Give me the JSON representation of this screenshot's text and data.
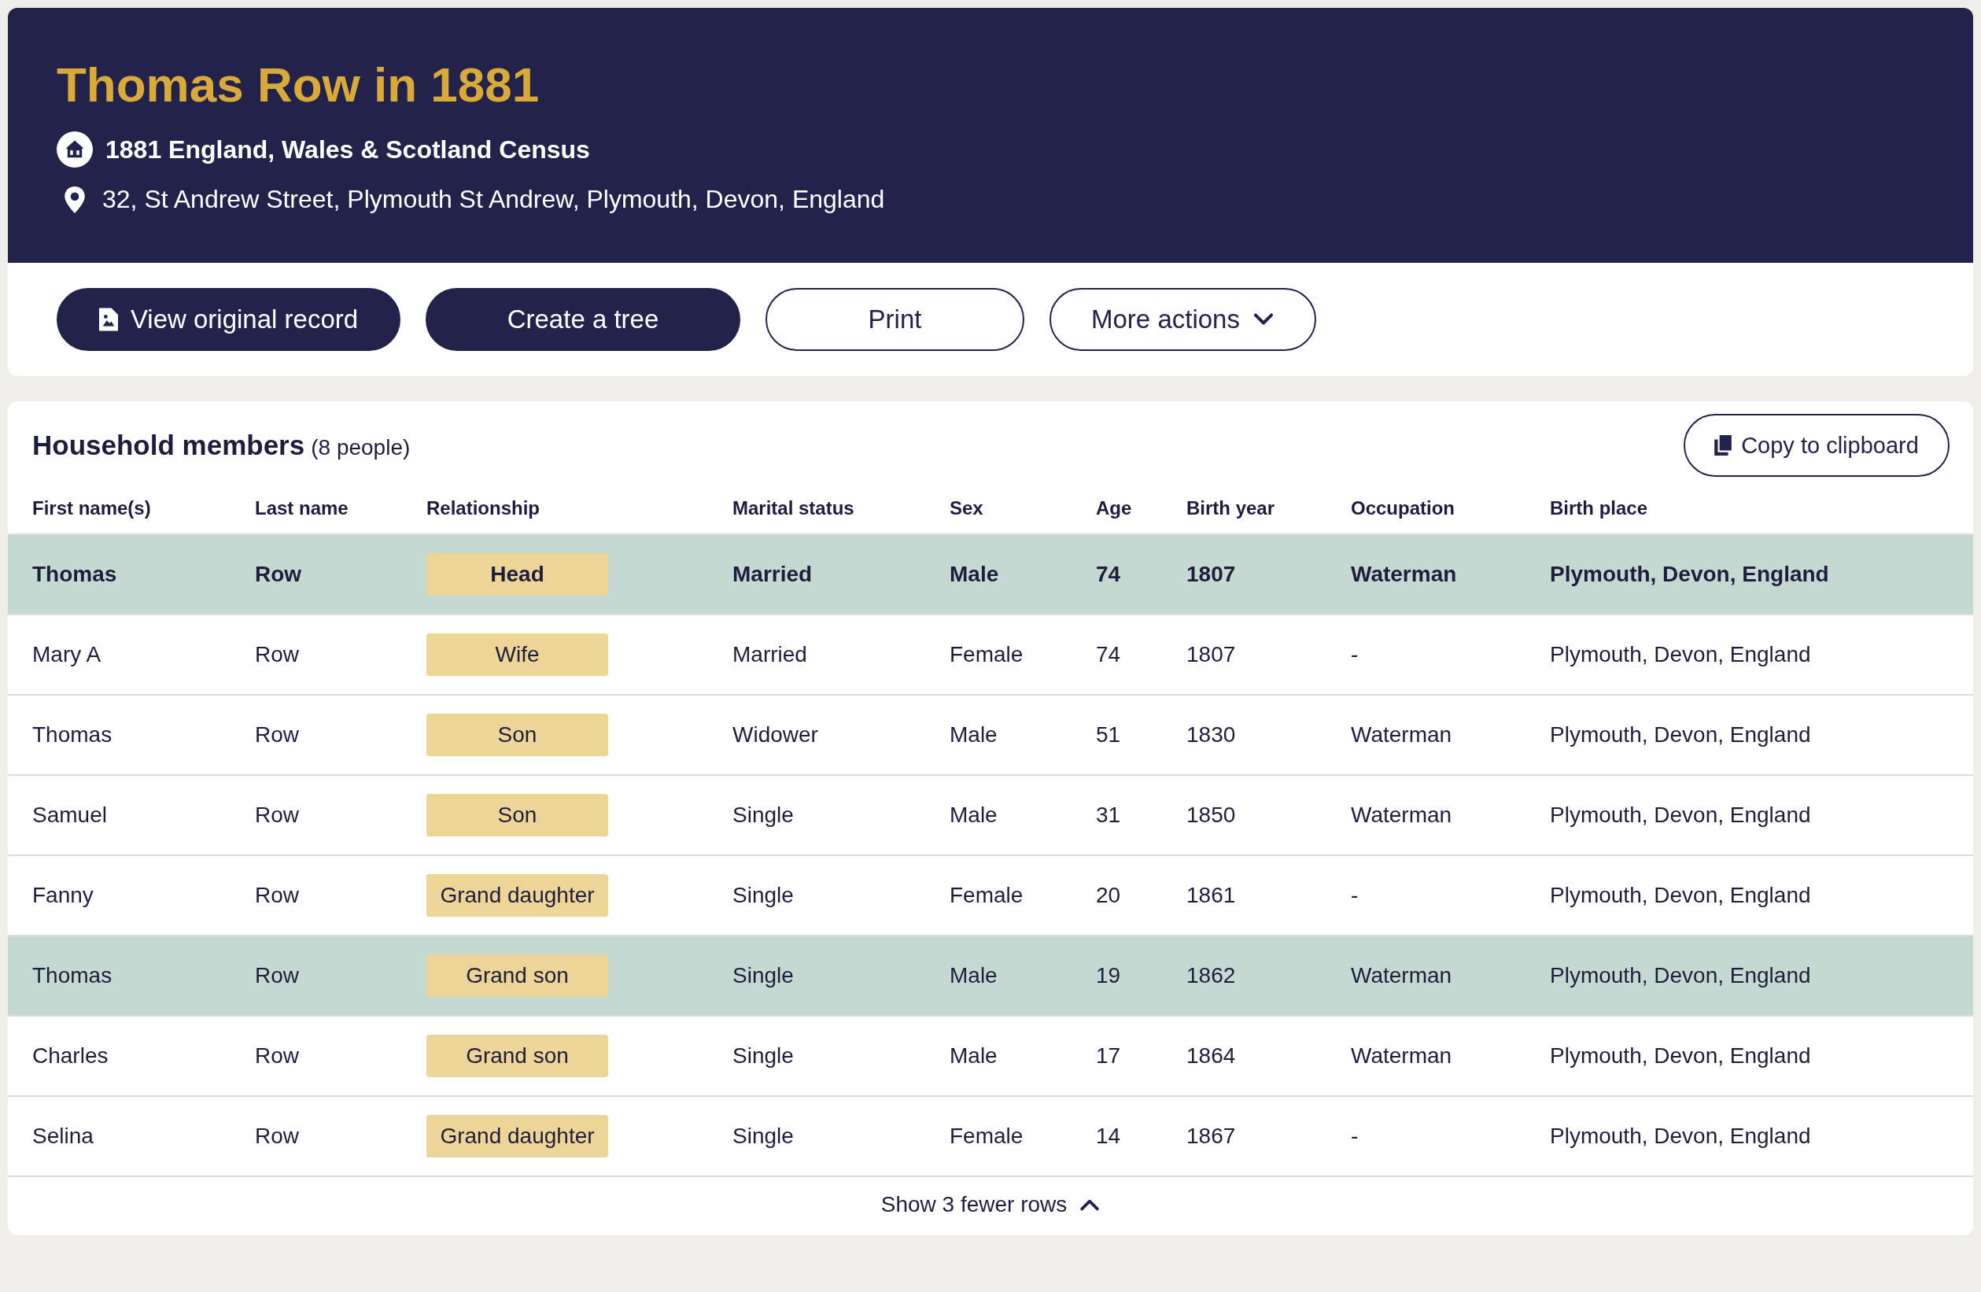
{
  "header": {
    "title": "Thomas Row in 1881",
    "collection": "1881 England, Wales & Scotland Census",
    "address": "32, St Andrew Street, Plymouth St Andrew, Plymouth, Devon, England"
  },
  "actions": [
    {
      "label": "View original record",
      "kind": "primary-icon"
    },
    {
      "label": "Create a tree",
      "kind": "primary"
    },
    {
      "label": "Print",
      "kind": "outline"
    },
    {
      "label": "More actions",
      "kind": "dropdown"
    }
  ],
  "household": {
    "title": "Household members",
    "count": "(8 people)",
    "copy_button": "Copy to clipboard",
    "columns": [
      "First name(s)",
      "Last name",
      "Relationship",
      "Marital status",
      "Sex",
      "Age",
      "Birth year",
      "Occupation",
      "Birth place"
    ],
    "rows": [
      {
        "cells": [
          "Thomas",
          "Row",
          "Head",
          "Married",
          "Male",
          "74",
          "1807",
          "Waterman",
          "Plymouth, Devon, England"
        ],
        "highlighted": true,
        "emphasized": true
      },
      {
        "cells": [
          "Mary A",
          "Row",
          "Wife",
          "Married",
          "Female",
          "74",
          "1807",
          "-",
          "Plymouth, Devon, England"
        ],
        "highlighted": false,
        "emphasized": false
      },
      {
        "cells": [
          "Thomas",
          "Row",
          "Son",
          "Widower",
          "Male",
          "51",
          "1830",
          "Waterman",
          "Plymouth, Devon, England"
        ],
        "highlighted": false,
        "emphasized": false
      },
      {
        "cells": [
          "Samuel",
          "Row",
          "Son",
          "Single",
          "Male",
          "31",
          "1850",
          "Waterman",
          "Plymouth, Devon, England"
        ],
        "highlighted": false,
        "emphasized": false
      },
      {
        "cells": [
          "Fanny",
          "Row",
          "Grand daughter",
          "Single",
          "Female",
          "20",
          "1861",
          "-",
          "Plymouth, Devon, England"
        ],
        "highlighted": false,
        "emphasized": false
      },
      {
        "cells": [
          "Thomas",
          "Row",
          "Grand son",
          "Single",
          "Male",
          "19",
          "1862",
          "Waterman",
          "Plymouth, Devon, England"
        ],
        "highlighted": true,
        "emphasized": false
      },
      {
        "cells": [
          "Charles",
          "Row",
          "Grand son",
          "Single",
          "Male",
          "17",
          "1864",
          "Waterman",
          "Plymouth, Devon, England"
        ],
        "highlighted": false,
        "emphasized": false
      },
      {
        "cells": [
          "Selina",
          "Row",
          "Grand daughter",
          "Single",
          "Female",
          "14",
          "1867",
          "-",
          "Plymouth, Devon, England"
        ],
        "highlighted": false,
        "emphasized": false
      }
    ],
    "toggle": "Show 3 fewer rows"
  }
}
